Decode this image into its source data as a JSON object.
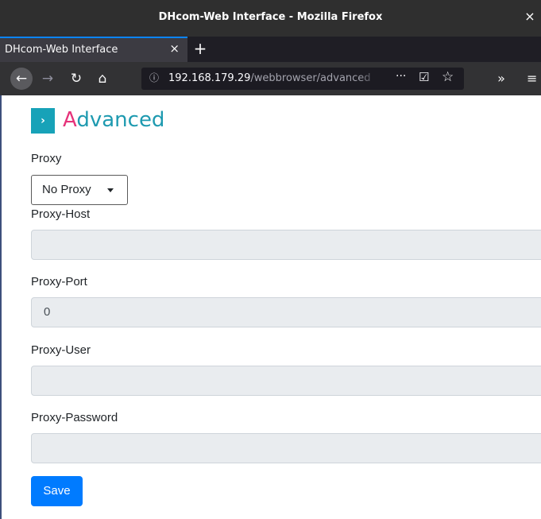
{
  "window": {
    "title": "DHcom-Web Interface - Mozilla Firefox",
    "close_glyph": "×"
  },
  "tabs": [
    {
      "label": "DHcom-Web Interface",
      "close_glyph": "×"
    }
  ],
  "newtab_glyph": "+",
  "toolbar": {
    "back_glyph": "←",
    "forward_glyph": "→",
    "reload_glyph": "↻",
    "home_glyph": "⌂",
    "overflow_glyph": "»",
    "menu_glyph": "≡"
  },
  "urlbar": {
    "info_glyph": "ⓘ",
    "host": "192.168.179.29",
    "path": "/webbrowser/advanced",
    "more_glyph": "···",
    "pocket_glyph": "☑",
    "star_glyph": "☆"
  },
  "page": {
    "chevron_glyph": "›",
    "heading_first": "A",
    "heading_rest": "dvanced",
    "proxy": {
      "label": "Proxy",
      "selected": "No Proxy"
    },
    "proxy_host": {
      "label": "Proxy-Host",
      "value": ""
    },
    "proxy_port": {
      "label": "Proxy-Port",
      "value": "0",
      "spin_up": "▲",
      "spin_down": "▼"
    },
    "proxy_user": {
      "label": "Proxy-User",
      "value": ""
    },
    "proxy_password": {
      "label": "Proxy-Password",
      "value": ""
    },
    "save_label": "Save"
  },
  "colors": {
    "accent_primary": "#007bff",
    "heading_teal": "#1e9ab0",
    "heading_pink": "#e6337a",
    "chevron_box": "#17a2b8"
  },
  "icons": {
    "window_close": "close-icon",
    "tab_close": "close-icon",
    "new_tab": "plus-icon",
    "back": "arrow-left-icon",
    "forward": "arrow-right-icon",
    "reload": "reload-icon",
    "home": "home-icon",
    "site_info": "info-icon",
    "page_actions": "more-icon",
    "pocket": "pocket-icon",
    "bookmark": "star-icon",
    "overflow": "chevron-double-right-icon",
    "menu": "hamburger-menu-icon",
    "heading_chevron": "chevron-right-icon",
    "dropdown_caret": "caret-down-icon"
  }
}
